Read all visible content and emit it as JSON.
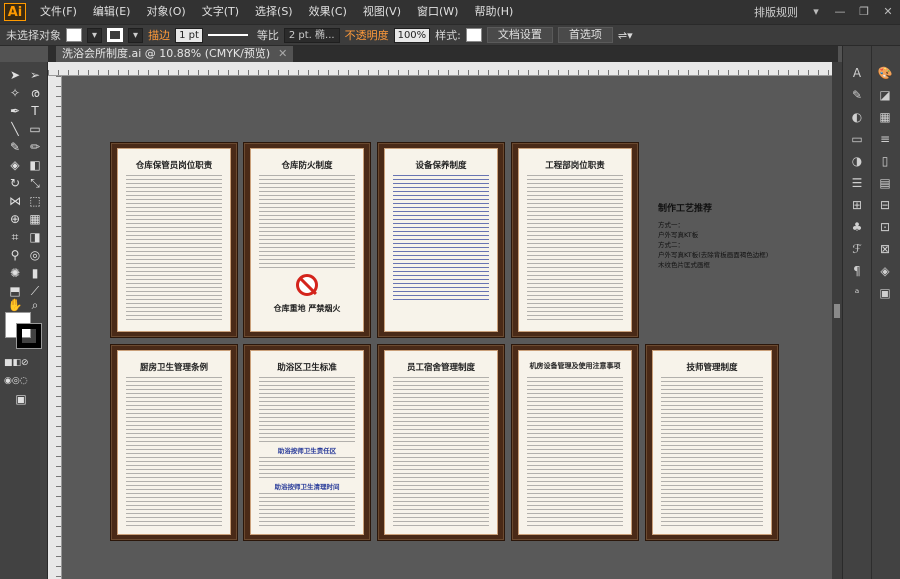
{
  "app": {
    "logo": "Ai"
  },
  "menu": {
    "items": [
      "文件(F)",
      "编辑(E)",
      "对象(O)",
      "文字(T)",
      "选择(S)",
      "效果(C)",
      "视图(V)",
      "窗口(W)",
      "帮助(H)"
    ],
    "workspace": "排版规则",
    "workspace_arrow": "▾",
    "win_min": "—",
    "win_max": "❐",
    "win_close": "✕"
  },
  "control": {
    "selection": "未选择对象",
    "stroke_label": "描边",
    "stroke_weight": "1 pt",
    "stroke_style": "等比",
    "brush": "2 pt. 椭...",
    "opacity_label": "不透明度",
    "opacity_value": "100%",
    "style_label": "样式:",
    "doc_setup_btn": "文档设置",
    "prefs_btn": "首选项"
  },
  "tab": {
    "title": "洗浴会所制度.ai @ 10.88% (CMYK/预览)",
    "close": "✕"
  },
  "boards": [
    {
      "title": "仓库保管员岗位职责"
    },
    {
      "title": "仓库防火制度",
      "footer": "仓库重地  严禁烟火"
    },
    {
      "title": "设备保养制度"
    },
    {
      "title": "工程部岗位职责"
    },
    {
      "title": "厨房卫生管理条例"
    },
    {
      "title": "助浴区卫生标准",
      "sub1": "助浴按师卫生责任区",
      "sub2": "助浴按师卫生清理时间"
    },
    {
      "title": "员工宿舍管理制度"
    },
    {
      "title": "机房设备管理及使用注意事项"
    },
    {
      "title": "技师管理制度"
    }
  ],
  "note": {
    "title": "制作工艺推荐",
    "lines": [
      "方式一：",
      "户外写真KT板",
      "方式二：",
      "户外写真KT板(去除背板画面褐色边框)",
      "木纹色片匡式画框"
    ]
  },
  "colors": {
    "board_frame": "#4a2a17",
    "board_paper": "#f7f3ea",
    "accent_orange": "#ff9a00"
  }
}
